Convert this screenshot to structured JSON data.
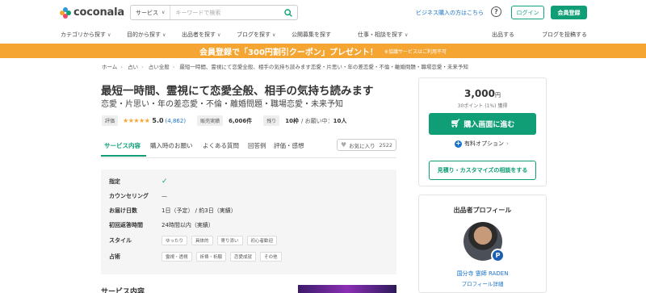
{
  "header": {
    "logo_text": "coconala",
    "search": {
      "category": "サービス",
      "placeholder": "キーワードで検索"
    },
    "business_link": "ビジネス購入の方はこちら",
    "help": "?",
    "login": "ログイン",
    "signup": "会員登録"
  },
  "nav": {
    "items": [
      "カテゴリから探す",
      "目的から探す",
      "出品者を探す",
      "ブログを探す",
      "公開募集を探す",
      "仕事・相談を探す",
      "出品する",
      "ブログを投稿する"
    ]
  },
  "banner": {
    "main": "会員登録で「300円割引クーポン」プレゼント！",
    "sub": "※協議サービスはご利用不可"
  },
  "breadcrumb": [
    "ホーム",
    "占い",
    "占い全般",
    "最短一時間、霊視にて恋愛全般、相手の気持ち読みます恋愛・片思い・年の差恋愛・不倫・離婚問題・職場恋愛・未来予知"
  ],
  "service": {
    "title": "最短一時間、霊視にて恋愛全般、相手の気持ち読みます",
    "subtitle": "恋愛・片思い・年の差恋愛・不倫・離婚問題・職場恋愛・未来予知",
    "rating_tag": "評価",
    "stars": "★★★★★",
    "rating": "5.0",
    "reviews": "(4,862)",
    "sales_tag": "販売実績",
    "sales": "6,006件",
    "remaining_tag": "残り",
    "remaining": "10枠",
    "inquiry_label": "/ お願い中：",
    "inquiry": "10人"
  },
  "tabs": {
    "items": [
      "サービス内容",
      "購入時のお願い",
      "よくある質問",
      "回答例",
      "評価・感想"
    ],
    "favorite_label": "お気に入り",
    "favorite_count": "2522"
  },
  "spec": {
    "designation_label": "指定",
    "counseling_label": "カウンセリング",
    "counseling_value": "—",
    "delivery_label": "お届け日数",
    "delivery_value": "1日（予定） / 約3日（実績）",
    "first_reply_label": "初回返答時間",
    "first_reply_value": "24時間以内（実績）",
    "style_label": "スタイル",
    "style_chips": [
      "ゆったり",
      "具体的",
      "寄り添い",
      "初心者歓迎"
    ],
    "method_label": "占術",
    "method_chips": [
      "霊視・透視",
      "祈祷・祈願",
      "恋愛成就",
      "その他"
    ]
  },
  "section_head": "サービス内容",
  "purchase": {
    "price": "3,000",
    "price_unit": "円",
    "points": "30ポイント (1%) 獲得",
    "buy_label": "購入画面に進む",
    "option_label": "有料オプション",
    "quote_label": "見積り・カスタマイズの相談をする"
  },
  "profile": {
    "heading": "出品者プロフィール",
    "name": "国分寺 霊師 RADEN",
    "link": "プロフィール詳細"
  },
  "colors": {
    "brand_green": "#0f9e76",
    "banner_orange": "#f5a532",
    "link_blue": "#1a73c8"
  }
}
